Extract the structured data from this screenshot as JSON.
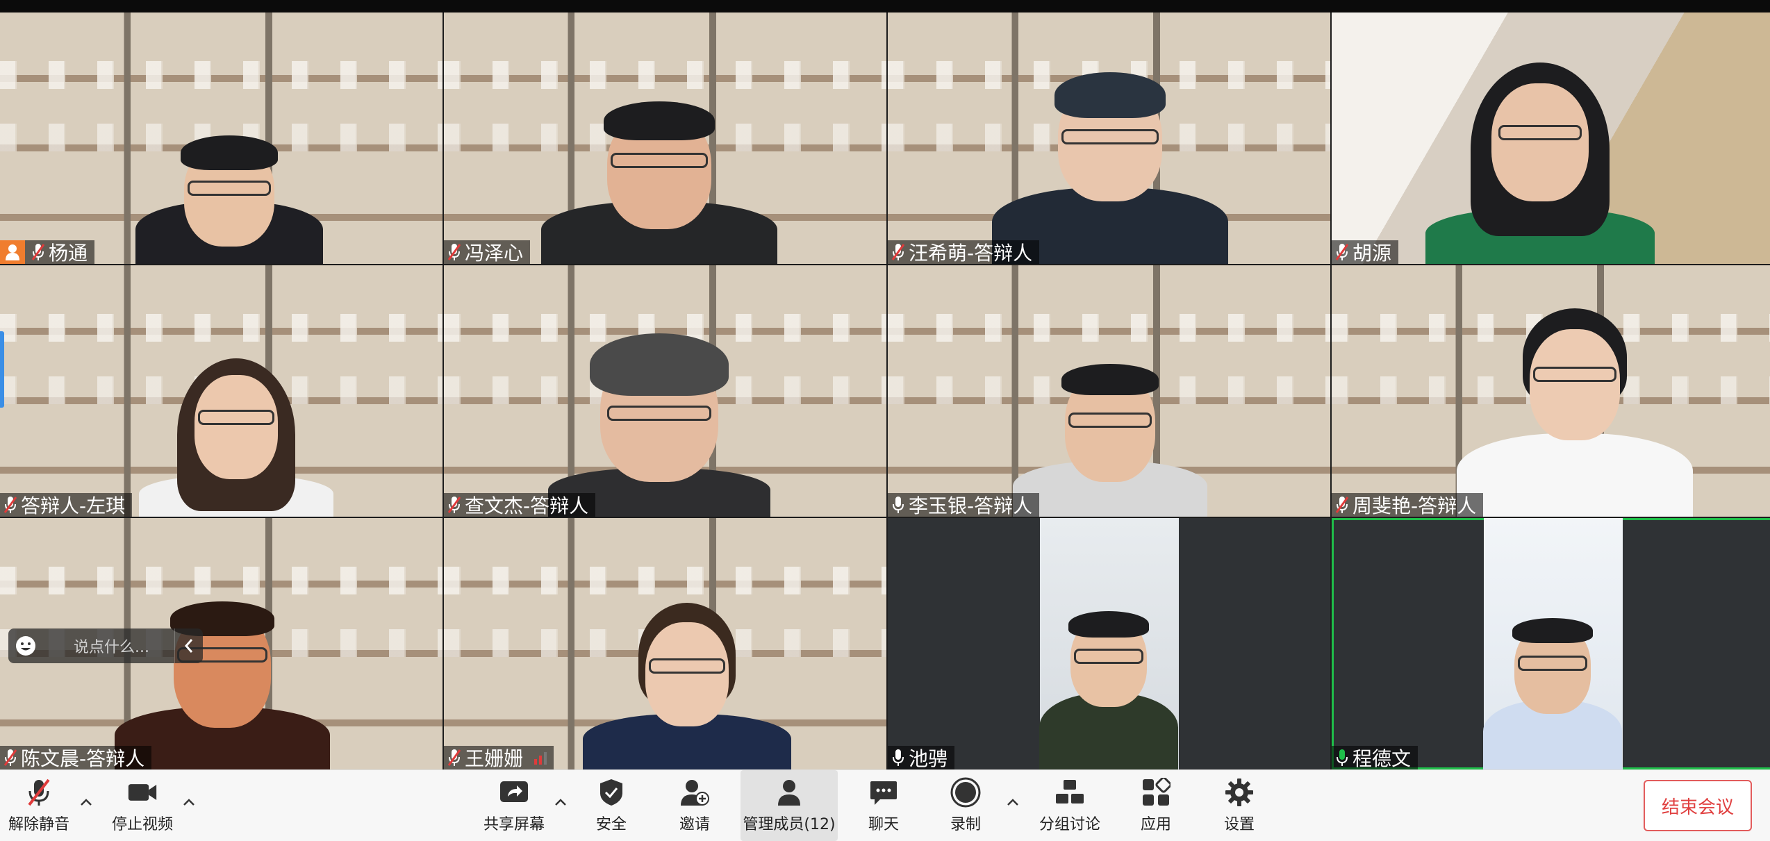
{
  "participants": [
    {
      "name": "杨通",
      "mic": "muted",
      "host": true
    },
    {
      "name": "冯泽心",
      "mic": "muted"
    },
    {
      "name": "汪希萌-答辩人",
      "mic": "muted"
    },
    {
      "name": "胡源",
      "mic": "muted"
    },
    {
      "name": "答辩人-左琪",
      "mic": "muted"
    },
    {
      "name": "查文杰-答辩人",
      "mic": "muted"
    },
    {
      "name": "李玉银-答辩人",
      "mic": "on"
    },
    {
      "name": "周斐艳-答辩人",
      "mic": "muted"
    },
    {
      "name": "陈文晨-答辩人",
      "mic": "muted"
    },
    {
      "name": "王姗姗",
      "mic": "muted",
      "weak_signal": true
    },
    {
      "name": "池骋",
      "mic": "on"
    },
    {
      "name": "程德文",
      "mic": "speaking",
      "active": true
    }
  ],
  "chat_float": {
    "placeholder": "说点什么..."
  },
  "toolbar": {
    "unmute": "解除静音",
    "stop_video": "停止视频",
    "share_screen": "共享屏幕",
    "security": "安全",
    "invite": "邀请",
    "manage_members": "管理成员(12)",
    "chat": "聊天",
    "record": "录制",
    "breakout": "分组讨论",
    "apps": "应用",
    "settings": "设置",
    "end_meeting": "结束会议"
  },
  "colors": {
    "host_badge": "#f07d2e",
    "muted_mic": "#e03b3b",
    "speaking": "#1fbf4a",
    "end_button": "#e04040"
  }
}
